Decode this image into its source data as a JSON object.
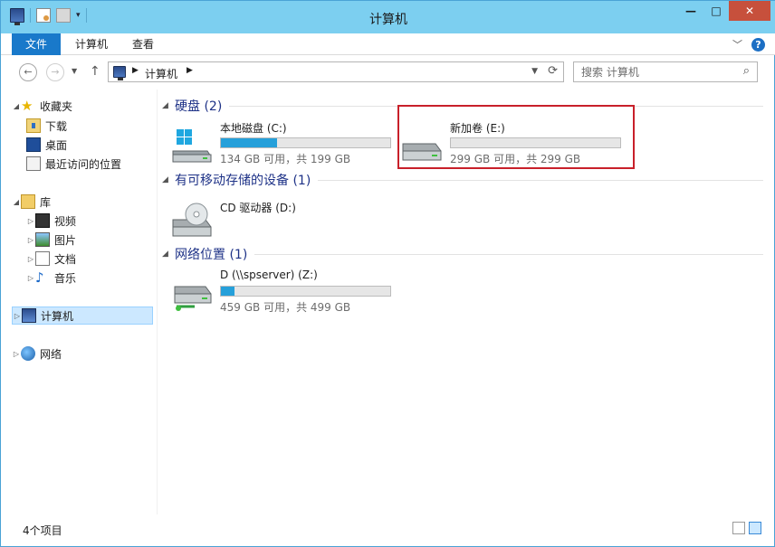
{
  "window": {
    "title": "计算机"
  },
  "ribbon": {
    "tabs": [
      "文件",
      "计算机",
      "查看"
    ]
  },
  "address": {
    "crumb": "计算机",
    "search_placeholder": "搜索 计算机"
  },
  "nav": {
    "favorites": "收藏夹",
    "fav_items": [
      "下载",
      "桌面",
      "最近访问的位置"
    ],
    "libraries": "库",
    "lib_items": [
      "视频",
      "图片",
      "文档",
      "音乐"
    ],
    "computer": "计算机",
    "network": "网络"
  },
  "groups": [
    {
      "label": "硬盘 (2)"
    },
    {
      "label": "有可移动存储的设备 (1)"
    },
    {
      "label": "网络位置 (1)"
    }
  ],
  "drives": [
    {
      "name": "本地磁盘 (C:)",
      "free_text": "134 GB 可用，共 199 GB",
      "used_fraction": 0.33
    },
    {
      "name": "新加卷 (E:)",
      "free_text": "299 GB 可用，共 299 GB",
      "used_fraction": 0.0
    },
    {
      "name": "CD 驱动器 (D:)"
    },
    {
      "name": "D (\\\\spserver) (Z:)",
      "free_text": "459 GB 可用，共 499 GB",
      "used_fraction": 0.08
    }
  ],
  "status": {
    "items_text": "4个项目"
  },
  "colors": {
    "titlebar": "#7ccff0",
    "file_tab": "#1979ca",
    "highlight": "#c8202a",
    "bar_fill": "#26a0da"
  }
}
